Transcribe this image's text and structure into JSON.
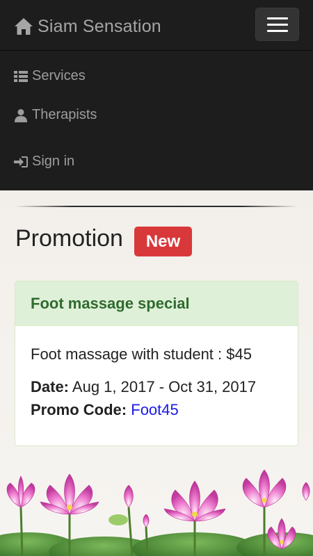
{
  "navbar": {
    "brand": "Siam Sensation",
    "brand_icon": "home-icon",
    "toggle_icon": "hamburger-menu-icon",
    "items": [
      {
        "label": "Services",
        "icon": "list-icon"
      },
      {
        "label": "Therapists",
        "icon": "user-icon"
      },
      {
        "label": "Sign in",
        "icon": "sign-in-icon"
      }
    ]
  },
  "main": {
    "title": "Promotion",
    "badge": "New",
    "panel": {
      "heading": "Foot massage special",
      "description": "Foot massage with student : $45",
      "date_label": "Date:",
      "date_value": "Aug 1, 2017 - Oct 31, 2017",
      "code_label": "Promo Code:",
      "code_value": "Foot45"
    }
  },
  "colors": {
    "navbar_bg": "#1d1d1d",
    "badge": "#d9383a",
    "panel_heading_bg": "#dff0d8",
    "panel_heading_text": "#2f6b2f",
    "link": "#1a1ae6"
  }
}
